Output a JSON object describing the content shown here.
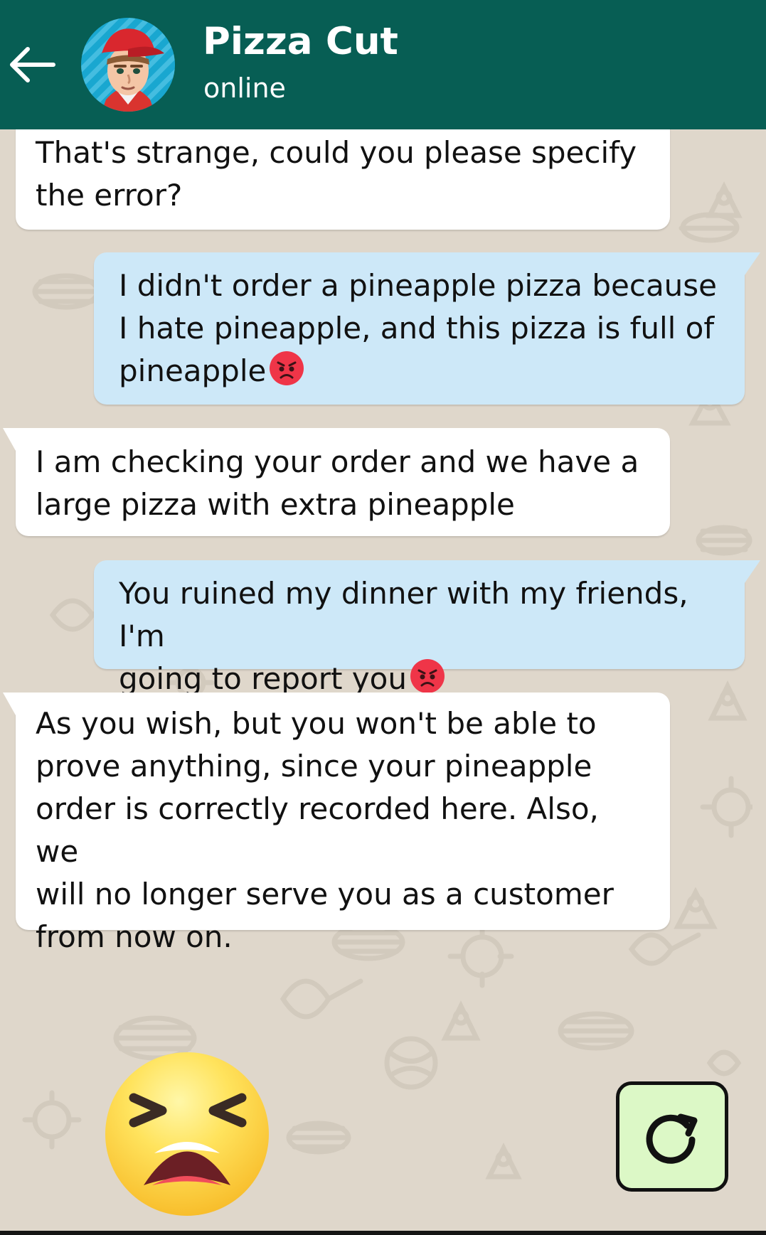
{
  "colors": {
    "header": "#075e54",
    "background": "#dfd7cb",
    "incoming_bubble": "#ffffff",
    "outgoing_bubble": "#cde8f8",
    "refresh_button": "#dcf8c6"
  },
  "header": {
    "back_icon": "back-arrow-icon",
    "avatar": "pizza-delivery-avatar",
    "title": "Pizza Cut",
    "status": "online"
  },
  "messages": [
    {
      "direction": "incoming",
      "text": "That's strange, could you please specify\nthe error?"
    },
    {
      "direction": "outgoing",
      "text": "I didn't order a pineapple pizza because\nI hate pineapple, and this pizza is full of\npineapple",
      "emoji": "angry-face-icon"
    },
    {
      "direction": "incoming",
      "text": "I am checking your order and we have a\nlarge pizza with extra pineapple"
    },
    {
      "direction": "outgoing",
      "text": "You ruined my dinner with my friends, I'm\ngoing to report you",
      "emoji": "angry-face-icon"
    },
    {
      "direction": "incoming",
      "text": "As you wish, but you won't be able to\nprove anything, since your pineapple\norder is correctly recorded here. Also, we\nwill no longer serve you as a customer\nfrom now on."
    }
  ],
  "footer": {
    "reaction_icon": "tired-face-icon",
    "refresh_icon": "refresh-icon"
  }
}
